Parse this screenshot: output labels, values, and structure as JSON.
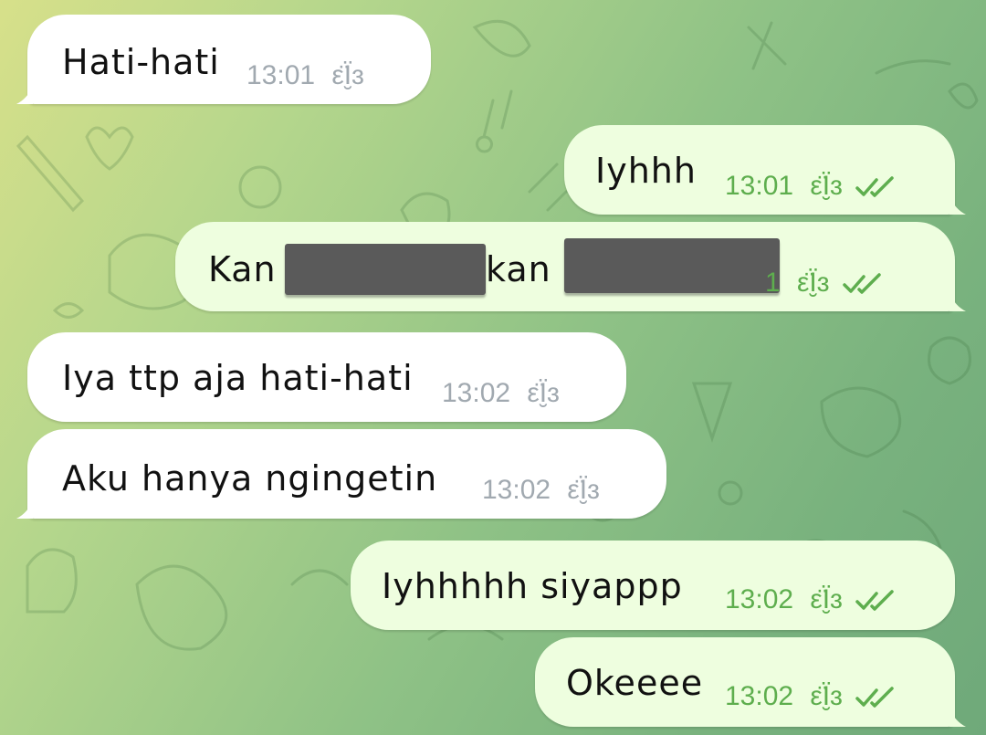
{
  "messages": [
    {
      "text": "Hati-hati",
      "time": "13:01",
      "emoji": "ε̈Ï̮ɜ",
      "direction": "incoming"
    },
    {
      "text": "Iyhhh",
      "time": "13:01",
      "emoji": "ε̈Ï̮ɜ",
      "direction": "outgoing",
      "status": "read"
    },
    {
      "text_start": "Kan",
      "text_mid": "kan",
      "time_partial": "1",
      "emoji": "ε̈Ï̮ɜ",
      "direction": "outgoing",
      "status": "read",
      "redacted": true
    },
    {
      "text": "Iya ttp aja hati-hati",
      "time": "13:02",
      "emoji": "ε̈Ï̮ɜ",
      "direction": "incoming"
    },
    {
      "text": "Aku hanya ngingetin",
      "time": "13:02",
      "emoji": "ε̈Ï̮ɜ",
      "direction": "incoming"
    },
    {
      "text": "Iyhhhhh siyappp",
      "time": "13:02",
      "emoji": "ε̈Ï̮ɜ",
      "direction": "outgoing",
      "status": "read"
    },
    {
      "text": "Okeeee",
      "time": "13:02",
      "emoji": "ε̈Ï̮ɜ",
      "direction": "outgoing",
      "status": "read"
    }
  ],
  "colors": {
    "incoming_bubble": "#ffffff",
    "outgoing_bubble": "#eefedf",
    "incoming_meta": "#a1a9b0",
    "outgoing_meta": "#5eae4e",
    "background_start": "#d7e08a",
    "background_end": "#6fa97a"
  },
  "icons": {
    "read_status": "double-check-icon",
    "background": "doodle-pattern"
  }
}
